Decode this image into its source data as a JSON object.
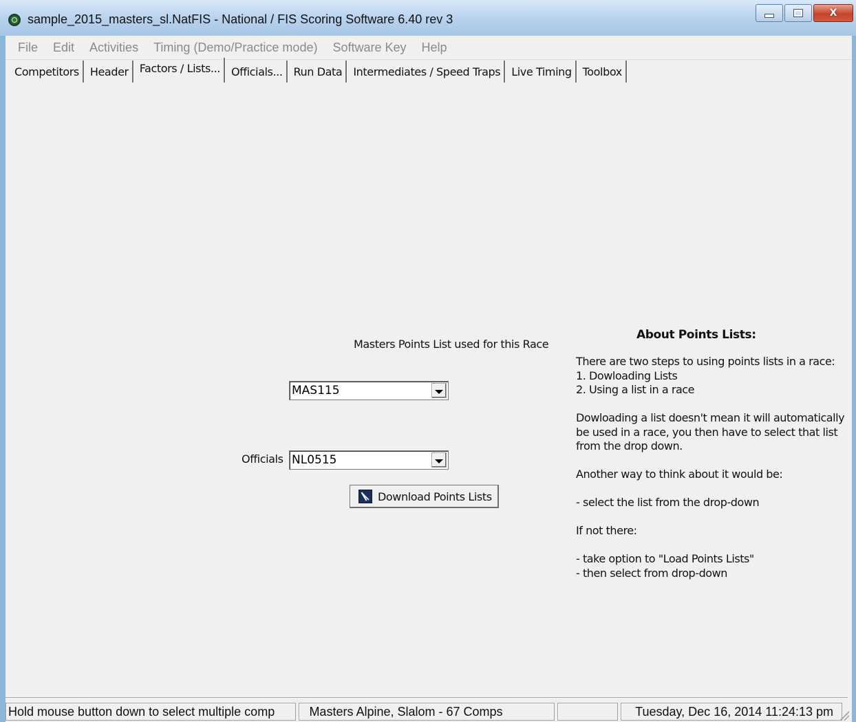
{
  "window": {
    "title": "sample_2015_masters_sl.NatFIS - National / FIS Scoring Software 6.40 rev 3",
    "minimize": "_",
    "maximize": "□",
    "close": "X"
  },
  "menu": {
    "items": [
      {
        "label": "File"
      },
      {
        "label": "Edit"
      },
      {
        "label": "Activities"
      },
      {
        "label": "Timing (Demo/Practice mode)"
      },
      {
        "label": "Software Key"
      },
      {
        "label": "Help"
      }
    ]
  },
  "tabs": [
    {
      "label": "Competitors",
      "active": false
    },
    {
      "label": "Header",
      "active": false
    },
    {
      "label": "Factors / Lists...",
      "active": true
    },
    {
      "label": "Officials...",
      "active": false
    },
    {
      "label": "Run Data",
      "active": false
    },
    {
      "label": "Intermediates / Speed Traps",
      "active": false
    },
    {
      "label": "Live Timing",
      "active": false
    },
    {
      "label": "Toolbox",
      "active": false
    }
  ],
  "form": {
    "points_list_label": "Masters Points List used for this Race",
    "points_list_value": "MAS115",
    "officials_label": "Officials",
    "officials_value": "NL0515",
    "download_button": "Download Points Lists"
  },
  "about": {
    "title": "About Points Lists:",
    "lines": [
      "There are two steps to using points lists in a race:",
      "1. Dowloading Lists",
      "2. Using a list in a race",
      "",
      "Dowloading a list doesn't mean it will automatically",
      "be used in a race, you then have to select that list",
      "from the drop down.",
      "",
      "Another way to think about it would be:",
      "",
      "- select the list from the drop-down",
      "",
      "If not there:",
      "",
      "- take option to \"Load Points Lists\"",
      "- then select from drop-down"
    ]
  },
  "status": {
    "hint": "Hold mouse button down to select multiple comp",
    "race": "Masters Alpine, Slalom - 67 Comps",
    "empty": "",
    "datetime": "Tuesday, Dec 16, 2014  11:24:13 pm"
  },
  "colors": {
    "titlebar": "#b9d3ee",
    "window_bg": "#f0f0f0",
    "close_button": "#c6442c",
    "menu_text_disabled": "#8a8a8a"
  }
}
